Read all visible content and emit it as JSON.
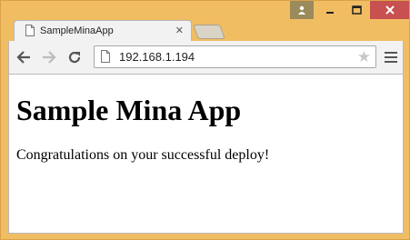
{
  "tab": {
    "title": "SampleMinaApp",
    "close_glyph": "✕"
  },
  "toolbar": {
    "url": "192.168.1.194",
    "star_glyph": "★"
  },
  "page": {
    "heading": "Sample Mina App",
    "message": "Congratulations on your successful deploy!"
  },
  "colors": {
    "frame": "#f1bd63",
    "close_button": "#c75050",
    "user_button": "#9a8a5c"
  }
}
